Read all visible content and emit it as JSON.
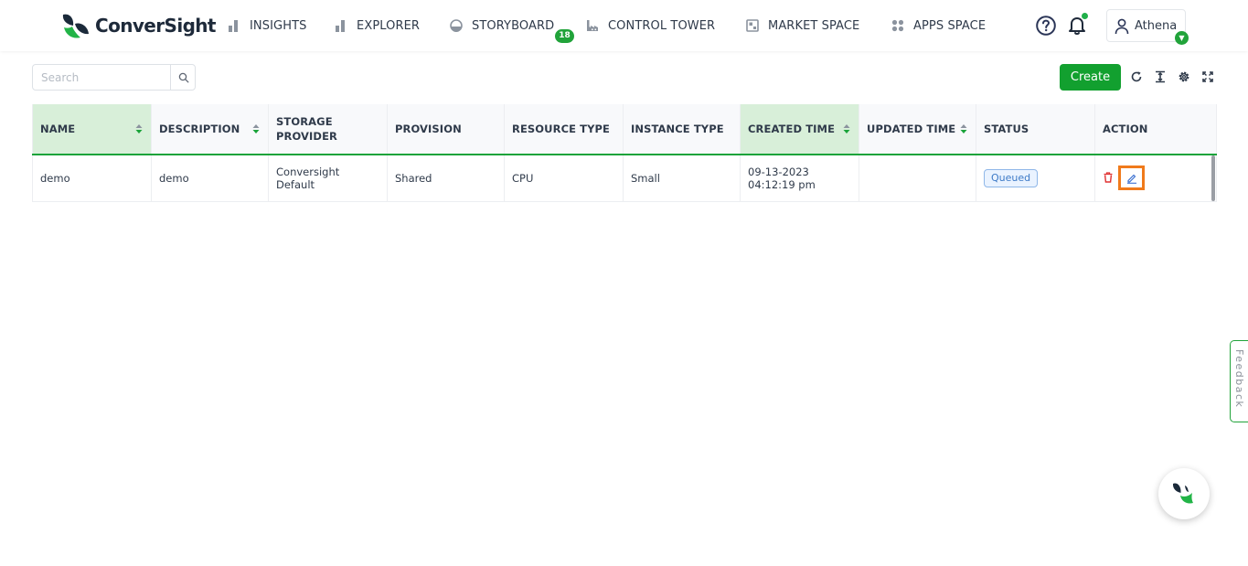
{
  "brand": {
    "name": "ConverSight",
    "accent": "#12a02f"
  },
  "nav": {
    "items": [
      {
        "label": "INSIGHTS",
        "icon": "bar-chart-icon"
      },
      {
        "label": "EXPLORER",
        "icon": "bar-chart-icon"
      },
      {
        "label": "STORYBOARD",
        "icon": "dashboard-gauge-icon",
        "badge": "18"
      },
      {
        "label": "CONTROL TOWER",
        "icon": "factory-icon"
      },
      {
        "label": "MARKET SPACE",
        "icon": "store-icon"
      },
      {
        "label": "APPS SPACE",
        "icon": "apps-grid-icon"
      }
    ]
  },
  "header": {
    "help_icon": "help-circle-icon",
    "bell_icon": "bell-icon",
    "user_name": "Athena"
  },
  "toolbar": {
    "search_placeholder": "Search",
    "search_value": "",
    "create_label": "Create",
    "icons": [
      "refresh-icon",
      "column-height-icon",
      "settings-icon",
      "fullscreen-icon"
    ]
  },
  "table": {
    "columns": [
      {
        "label": "NAME",
        "sortable": true,
        "sorted": true
      },
      {
        "label": "DESCRIPTION",
        "sortable": true,
        "sorted": false
      },
      {
        "label": "STORAGE PROVIDER",
        "sortable": false,
        "sorted": false
      },
      {
        "label": "PROVISION",
        "sortable": false,
        "sorted": false
      },
      {
        "label": "RESOURCE TYPE",
        "sortable": false,
        "sorted": false
      },
      {
        "label": "INSTANCE TYPE",
        "sortable": false,
        "sorted": false
      },
      {
        "label": "CREATED TIME",
        "sortable": true,
        "sorted": true
      },
      {
        "label": "UPDATED TIME",
        "sortable": true,
        "sorted": false
      },
      {
        "label": "STATUS",
        "sortable": false,
        "sorted": false
      },
      {
        "label": "ACTION",
        "sortable": false,
        "sorted": false
      }
    ],
    "rows": [
      {
        "name": "demo",
        "description": "demo",
        "storage_provider": "Conversight Default",
        "provision": "Shared",
        "resource_type": "CPU",
        "instance_type": "Small",
        "created_time": "09-13-2023 04:12:19 pm",
        "updated_time": "",
        "status": "Queued"
      }
    ]
  },
  "feedback": {
    "label": "Feedback"
  }
}
